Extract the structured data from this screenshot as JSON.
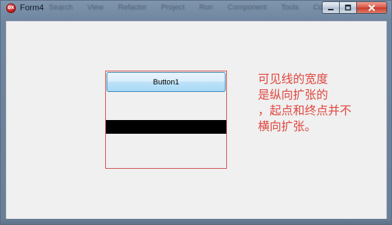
{
  "window": {
    "title": "Form4",
    "app_icon_text": "DX",
    "background_menu_items": [
      "Search",
      "View",
      "Refactor",
      "Project",
      "Run",
      "Component",
      "Tools",
      "Coll"
    ],
    "caption": {
      "minimize_icon": "minimize-icon",
      "maximize_icon": "maximize-icon",
      "close_icon": "close-icon"
    }
  },
  "form": {
    "button1_label": "Button1",
    "panel_border_color": "#d24a4a",
    "bar_color": "#000000"
  },
  "note": {
    "lines": [
      "可见线的宽度",
      "是纵向扩张的",
      "，起点和终点并不",
      "横向扩张。"
    ],
    "color": "#e0473f"
  }
}
